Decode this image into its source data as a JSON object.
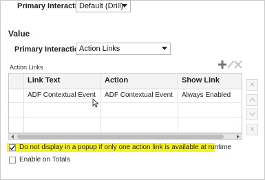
{
  "top": {
    "primary_interaction_label": "Primary Interaction",
    "primary_interaction_value": "Default (Drill)"
  },
  "value_section": {
    "title": "Value",
    "primary_interaction_label": "Primary Interaction",
    "primary_interaction_value": "Action Links"
  },
  "action_links": {
    "label": "Action Links",
    "columns": [
      "Link Text",
      "Action",
      "Show Link"
    ],
    "rows": [
      [
        "ADF Contextual Event",
        "ADF Contextual Event",
        "Always Enabled"
      ]
    ]
  },
  "toolbar": {
    "add_icon": "plus-icon",
    "edit_icon": "pencil-icon",
    "delete_icon": "x-icon"
  },
  "side_buttons": [
    "x-icon",
    "chevron-up-icon",
    "chevron-down-icon",
    "x-icon"
  ],
  "options": {
    "no_popup_label": "Do not display in a popup if only one action link is available at runtime",
    "no_popup_checked": true,
    "enable_on_totals_label": "Enable on Totals",
    "enable_on_totals_checked": false
  },
  "colors": {
    "highlight": "#f7f21b"
  }
}
